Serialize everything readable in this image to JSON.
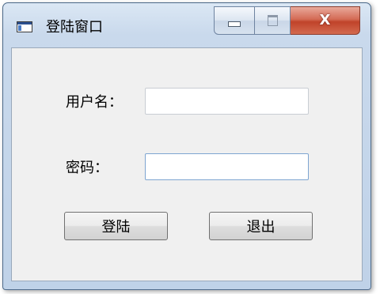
{
  "window": {
    "title": "登陆窗口",
    "close_glyph": "X"
  },
  "form": {
    "username_label": "用户名：",
    "username_value": "",
    "password_label": "密码：",
    "password_value": ""
  },
  "buttons": {
    "login_label": "登陆",
    "exit_label": "退出"
  },
  "icons": {
    "app": "window-app-icon",
    "minimize": "minimize-icon",
    "maximize": "maximize-icon",
    "close": "close-icon"
  }
}
